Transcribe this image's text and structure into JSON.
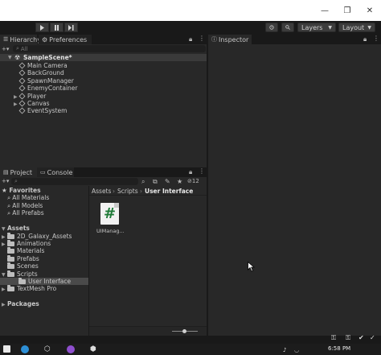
{
  "window_controls": {
    "minimize": "—",
    "maximize": "❐",
    "close": "✕"
  },
  "toolbar": {
    "play_icon": "play-icon",
    "pause_icon": "pause-icon",
    "step_icon": "step-icon",
    "layers_label": "Layers",
    "layout_label": "Layout"
  },
  "hierarchy": {
    "tab_label": "Hierarchy",
    "second_tab_label": "Preferences",
    "search_placeholder": "All",
    "scene_name": "SampleScene*",
    "items": [
      {
        "label": "Main Camera",
        "expandable": false
      },
      {
        "label": "BackGround",
        "expandable": false
      },
      {
        "label": "SpawnManager",
        "expandable": false
      },
      {
        "label": "EnemyContainer",
        "expandable": false
      },
      {
        "label": "Player",
        "expandable": true
      },
      {
        "label": "Canvas",
        "expandable": true
      },
      {
        "label": "EventSystem",
        "expandable": false
      }
    ]
  },
  "inspector": {
    "tab_label": "Inspector"
  },
  "project": {
    "tab_label": "Project",
    "second_tab_label": "Console",
    "hidden_count": "12",
    "favorites": {
      "label": "Favorites",
      "items": [
        "All Materials",
        "All Models",
        "All Prefabs"
      ]
    },
    "assets": {
      "label": "Assets",
      "items": [
        {
          "label": "2D_Galaxy_Assets",
          "expandable": true,
          "level": 1
        },
        {
          "label": "Animations",
          "expandable": true,
          "level": 1
        },
        {
          "label": "Materials",
          "expandable": false,
          "level": 1
        },
        {
          "label": "Prefabs",
          "expandable": false,
          "level": 1
        },
        {
          "label": "Scenes",
          "expandable": false,
          "level": 1
        },
        {
          "label": "Scripts",
          "expandable": true,
          "expanded": true,
          "level": 1
        },
        {
          "label": "User Interface",
          "expandable": false,
          "level": 2,
          "selected": true
        },
        {
          "label": "TextMesh Pro",
          "expandable": true,
          "level": 1
        }
      ]
    },
    "packages_label": "Packages",
    "breadcrumb": [
      "Assets",
      "Scripts",
      "User Interface"
    ],
    "files": [
      {
        "name": "UIManag...",
        "icon": "csharp-script-icon"
      }
    ]
  },
  "taskbar": {
    "time": "6:58 PM"
  }
}
